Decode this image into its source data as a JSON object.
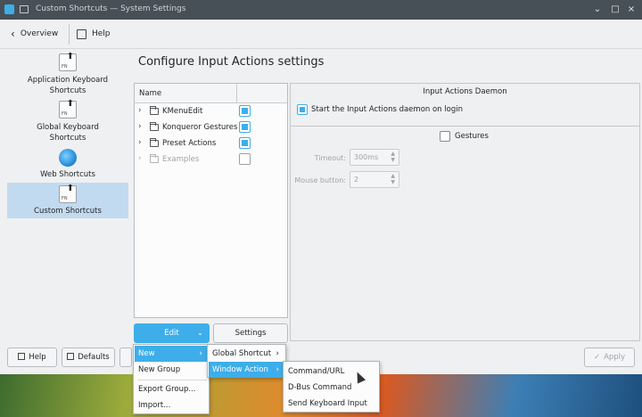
{
  "titlebar": {
    "title": "Custom Shortcuts — System Settings",
    "minimize": "⌄",
    "maximize": "⌃",
    "restore": "□",
    "close": "×"
  },
  "toolbar": {
    "back_label": "Overview",
    "help_label": "Help"
  },
  "sidebar": {
    "items": [
      {
        "label": "Application Keyboard Shortcuts",
        "icon": "keyboard-fn-icon"
      },
      {
        "label": "Global Keyboard Shortcuts",
        "icon": "keyboard-fn-icon"
      },
      {
        "label": "Web Shortcuts",
        "icon": "globe-icon"
      },
      {
        "label": "Custom Shortcuts",
        "icon": "keyboard-fn-icon",
        "active": true
      }
    ]
  },
  "page": {
    "title": "Configure Input Actions settings"
  },
  "tree": {
    "header": "Name",
    "rows": [
      {
        "label": "KMenuEdit",
        "checked": true
      },
      {
        "label": "Konqueror Gestures",
        "checked": true
      },
      {
        "label": "Preset Actions",
        "checked": true
      },
      {
        "label": "Examples",
        "checked": false,
        "disabled": true
      }
    ]
  },
  "daemon": {
    "title": "Input Actions Daemon",
    "start_label": "Start the Input Actions daemon on login"
  },
  "gestures": {
    "label": "Gestures",
    "timeout_label": "Timeout:",
    "timeout_value": "300ms",
    "button_label": "Mouse button:",
    "button_value": "2"
  },
  "buttons": {
    "edit": "Edit",
    "settings": "Settings",
    "help": "Help",
    "defaults": "Defaults",
    "apply": "Apply"
  },
  "menu_edit": {
    "items": [
      "New",
      "New Group",
      "Export Group...",
      "Import..."
    ]
  },
  "menu_new": {
    "items": [
      "Global Shortcut",
      "Window Action"
    ]
  },
  "menu_window_action": {
    "items": [
      "Command/URL",
      "D-Bus Command",
      "Send Keyboard Input"
    ]
  },
  "colors": {
    "accent": "#3daee9",
    "titlebar": "#475057",
    "window_bg": "#eff0f1",
    "selected_sidebar": "#c2daf0"
  }
}
